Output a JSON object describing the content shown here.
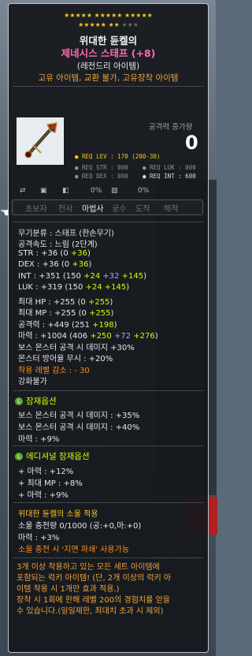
{
  "stars": {
    "row1": "★★★★★ ★★★★★ ★★★★★",
    "row2_on": "★★★★★ ★★",
    "row2_off": "★★★"
  },
  "item": {
    "name_line1": "위대한 듄켈의",
    "name_line2": "제네시스 스태프 (+8)",
    "grade": "(레전드리 아이템)",
    "tags": "고유 아이템, 교환 불가, 고유장착 아이템"
  },
  "attack": {
    "label": "공격력 증가량",
    "value": "0"
  },
  "req": {
    "lev": "● REQ LEV : 170 (200-30)",
    "str": "● REQ STR : 000",
    "luk": "● REQ LUK : 000",
    "dex": "● REQ DEX : 000",
    "int": "● REQ INT : 600"
  },
  "small_icons": {
    "pct1": "0%",
    "pct2": "0%"
  },
  "jobs": [
    "초보자",
    "전사",
    "마법사",
    "궁수",
    "도적",
    "해적"
  ],
  "stats": {
    "category": "무기분류 : 스태프 (한손무기)",
    "speed": "공격속도 : 느림 (2단계)",
    "str": {
      "a": "STR : +36 (0 ",
      "b": "+36",
      "c": ")"
    },
    "dex": {
      "a": "DEX : +36 (0 ",
      "b": "+36",
      "c": ")"
    },
    "int": {
      "a": "INT : +351 (150 ",
      "b": "+24",
      "c": " ",
      "d": "+32",
      "e": " ",
      "f": "+145",
      "g": ")"
    },
    "luk": {
      "a": "LUK : +319 (150 ",
      "b": "+24",
      "c": " ",
      "d": "+145",
      "e": ")"
    },
    "hp": {
      "a": "최대 HP : +255 (0 ",
      "b": "+255",
      "c": ")"
    },
    "mp": {
      "a": "최대 MP : +255 (0 ",
      "b": "+255",
      "c": ")"
    },
    "atk": {
      "a": "공격력 : +449 (251 ",
      "b": "+198",
      "c": ")"
    },
    "matk": {
      "a": "마력 : +1004 (406 ",
      "b": "+250",
      "c": " ",
      "d": "+72",
      "e": " ",
      "f": "+276",
      "g": ")"
    },
    "boss": "보스 몬스터 공격 시 데미지 +30%",
    "ignore": "몬스터 방어율 무시 : +20%",
    "reqlv": "착용 레벨 감소 : - 30",
    "enhance": "강화불가"
  },
  "potential": {
    "title": "잠재옵션",
    "lines": [
      "보스 몬스터 공격 시 데미지 : +35%",
      "보스 몬스터 공격 시 데미지 : +40%",
      "마력 : +9%"
    ]
  },
  "additional": {
    "title": "에디셔널 잠재옵션",
    "lines": [
      "+ 마력 : +12%",
      "+ 최대 MP : +8%",
      "+ 마력 : +9%"
    ]
  },
  "soul": {
    "title": "위대한 듄켈의 소울 적용",
    "charge": "소울 충전량 0/1000 (공:+0,마:+0)",
    "stat": "마력 : +3%",
    "skill": "소울 충전 시 '지면 파쇄' 사용가능"
  },
  "description": [
    "3개 이상 착용하고 있는 모든 세트 아이템에",
    "포함되는 럭키 아이템! (단, 2개 이상의 럭키 아",
    "이템 착용 시 1개만 효과 적용.)",
    "장착 시 1회에 한해 레벨 200의 경험치를 얻을",
    "수 있습니다.(일일제한, 최대치 초과 시 제외)"
  ],
  "colors": {
    "star": "#f5c823",
    "pink": "#ff6ab0",
    "orange": "#f0a23a",
    "green": "#ccff00",
    "purple": "#bb99ff"
  }
}
